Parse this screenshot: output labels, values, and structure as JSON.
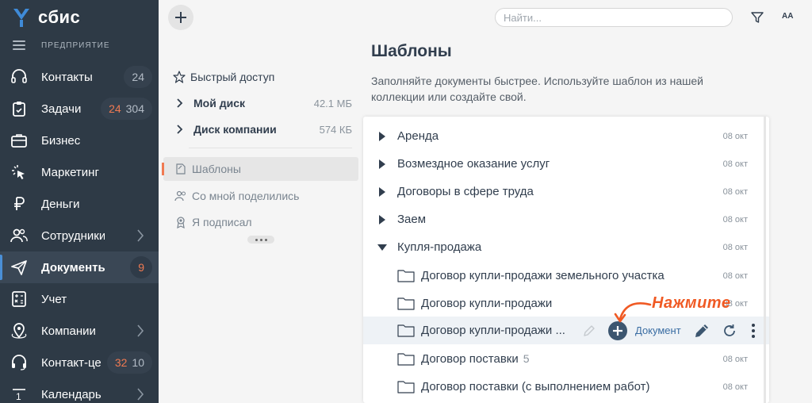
{
  "app": {
    "name": "сбис",
    "org_label": "ПРЕДПРИЯТИЕ"
  },
  "sidebar": {
    "items": [
      {
        "label": "Контакты",
        "count": "24"
      },
      {
        "label": "Задачи",
        "count_red": "24",
        "count": "304"
      },
      {
        "label": "Бизнес"
      },
      {
        "label": "Маркетинг"
      },
      {
        "label": "Деньги"
      },
      {
        "label": "Сотрудники"
      },
      {
        "label": "Документы",
        "count_red": "9"
      },
      {
        "label": "Учет"
      },
      {
        "label": "Компании"
      },
      {
        "label": "Контакт-це",
        "count_red": "32",
        "count": "10"
      },
      {
        "label": "Календарь"
      }
    ]
  },
  "folders": {
    "quick_access": "Быстрый доступ",
    "my_disk": "Мой диск",
    "my_disk_size": "42.1 МБ",
    "company_disk": "Диск компании",
    "company_disk_size": "574 КБ",
    "templates": "Шаблоны",
    "shared": "Со мной поделились",
    "signed": "Я подписал"
  },
  "toolbar": {
    "search_placeholder": "Найти...",
    "font_label": "AA"
  },
  "main": {
    "title": "Шаблоны",
    "description": "Заполняйте документы быстрее. Используйте шаблон из нашей коллекции или создайте свой."
  },
  "rows": [
    {
      "label": "Аренда",
      "date": "08 окт"
    },
    {
      "label": "Возмездное оказание услуг",
      "date": "08 окт"
    },
    {
      "label": "Договоры в сфере труда",
      "date": "08 окт"
    },
    {
      "label": "Заем",
      "date": "08 окт"
    },
    {
      "label": "Купля-продажа",
      "date": "08 окт"
    },
    {
      "label": "Договор купли-продажи земельного участка",
      "date": "08 окт"
    },
    {
      "label": "Договор купли-продажи",
      "date": "08 окт"
    },
    {
      "label": "Договор купли-продажи ..."
    },
    {
      "label": "Договор поставки",
      "count": "5",
      "date": "08 окт"
    },
    {
      "label": "Договор поставки (с выполнением работ)",
      "date": "08 окт"
    }
  ],
  "row_actions": {
    "document_label": "Документ"
  },
  "hint": {
    "text": "Нажмите"
  },
  "colors": {
    "sidebar": "#2e3a46",
    "accent": "#f07a52",
    "hint": "#f05a24",
    "link": "#3a6da3"
  }
}
